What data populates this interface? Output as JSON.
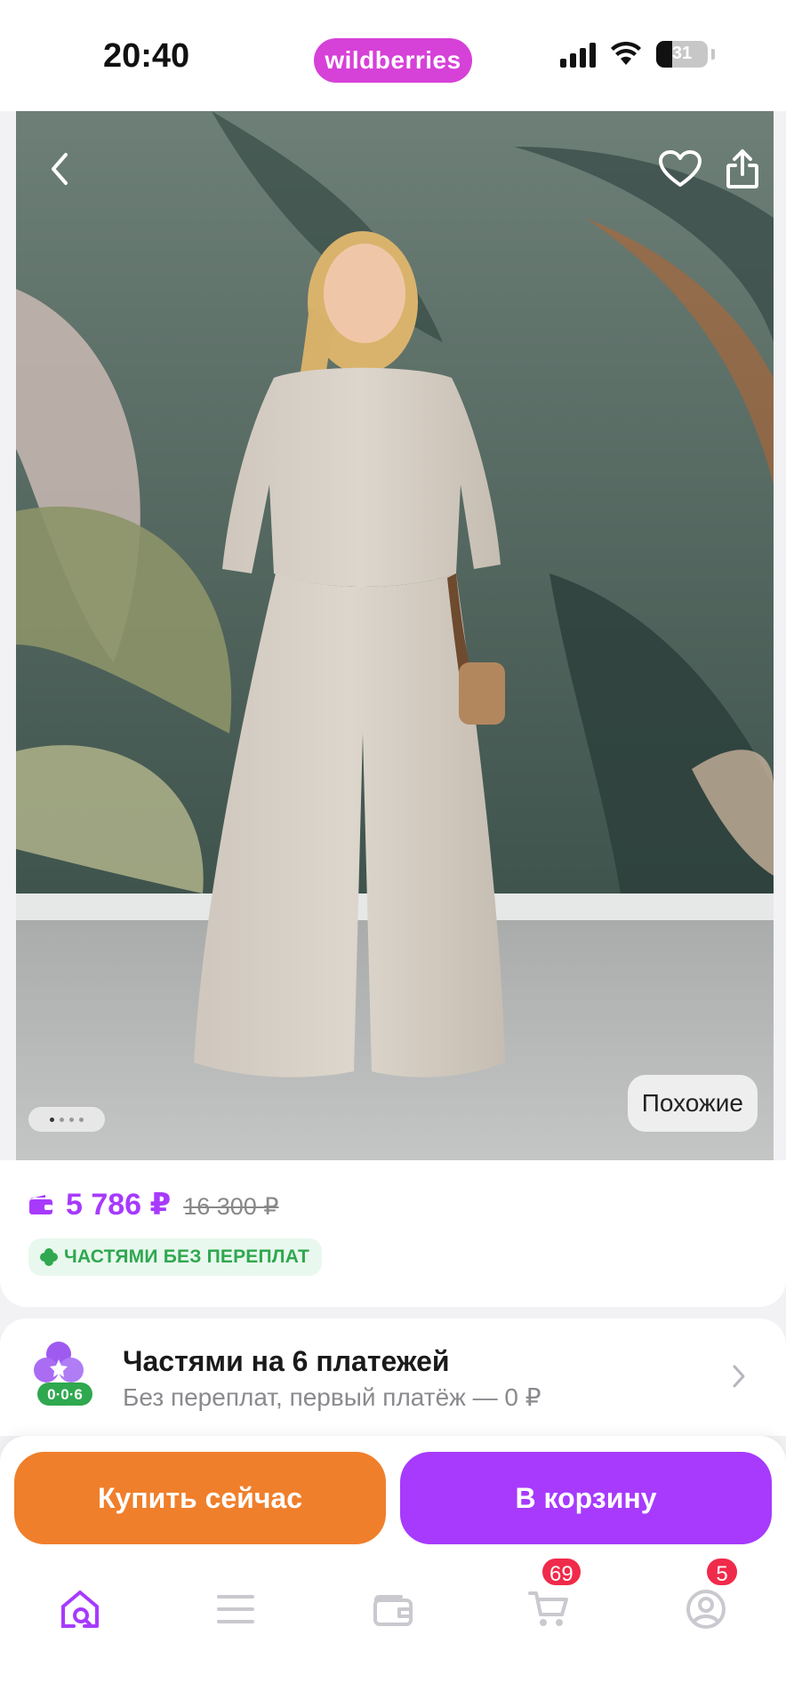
{
  "status_bar": {
    "time": "20:40",
    "brand": "wildberries",
    "battery": "31"
  },
  "hero": {
    "similar_label": "Похожие",
    "image_count": 4,
    "active_image": 0
  },
  "product": {
    "price_now": "5 786 ₽",
    "price_old": "16 300 ₽",
    "installment_badge": "ЧАСТЯМИ БЕЗ ПЕРЕПЛАТ"
  },
  "installment_card": {
    "icon_label": "0·0·6",
    "title": "Частями на 6 платежей",
    "subtitle": "Без переплат, первый платёж — 0 ₽"
  },
  "actions": {
    "buy_now": "Купить сейчас",
    "add_to_cart": "В корзину"
  },
  "tabbar": {
    "cart_badge": "69",
    "profile_badge": "5"
  },
  "colors": {
    "accent": "#a73afd",
    "brand_pill": "#d641d8",
    "buy_button": "#f07f2b",
    "badge": "#f02a4a",
    "installment_green": "#2fa84f"
  }
}
